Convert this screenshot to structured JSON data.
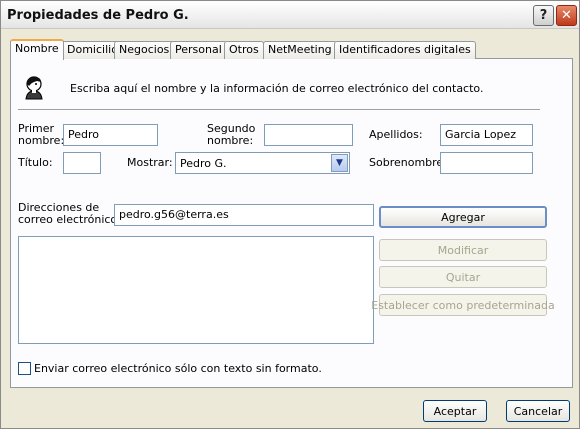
{
  "window": {
    "title": "Propiedades de Pedro G.",
    "help_label": "?",
    "close_label": "✕"
  },
  "tabs": [
    {
      "label": "Nombre",
      "active": true
    },
    {
      "label": "Domicilio"
    },
    {
      "label": "Negocios"
    },
    {
      "label": "Personal"
    },
    {
      "label": "Otros"
    },
    {
      "label": "NetMeeting"
    },
    {
      "label": "Identificadores digitales"
    }
  ],
  "intro_text": "Escriba aquí el nombre y la información de correo electrónico del contacto.",
  "form": {
    "primer_nombre_label_1": "Primer",
    "primer_nombre_label_2": "nombre:",
    "primer_nombre_value": "Pedro",
    "segundo_nombre_label_1": "Segundo",
    "segundo_nombre_label_2": "nombre:",
    "segundo_nombre_value": "",
    "apellidos_label": "Apellidos:",
    "apellidos_value": "Garcia Lopez",
    "titulo_label": "Título:",
    "titulo_value": "",
    "mostrar_label": "Mostrar:",
    "mostrar_value": "Pedro G.",
    "sobrenombre_label": "Sobrenombre:",
    "sobrenombre_value": ""
  },
  "email": {
    "label_1": "Direcciones de",
    "label_2": "correo electrónico:",
    "value": "pedro.g56@terra.es",
    "add_button": "Agregar",
    "modify_button": "Modificar",
    "remove_button": "Quitar",
    "default_button": "Establecer como predeterminada"
  },
  "plain_text_checkbox": {
    "label": "Enviar correo electrónico sólo con texto sin formato.",
    "checked": false
  },
  "footer": {
    "ok_button": "Aceptar",
    "cancel_button": "Cancelar"
  }
}
